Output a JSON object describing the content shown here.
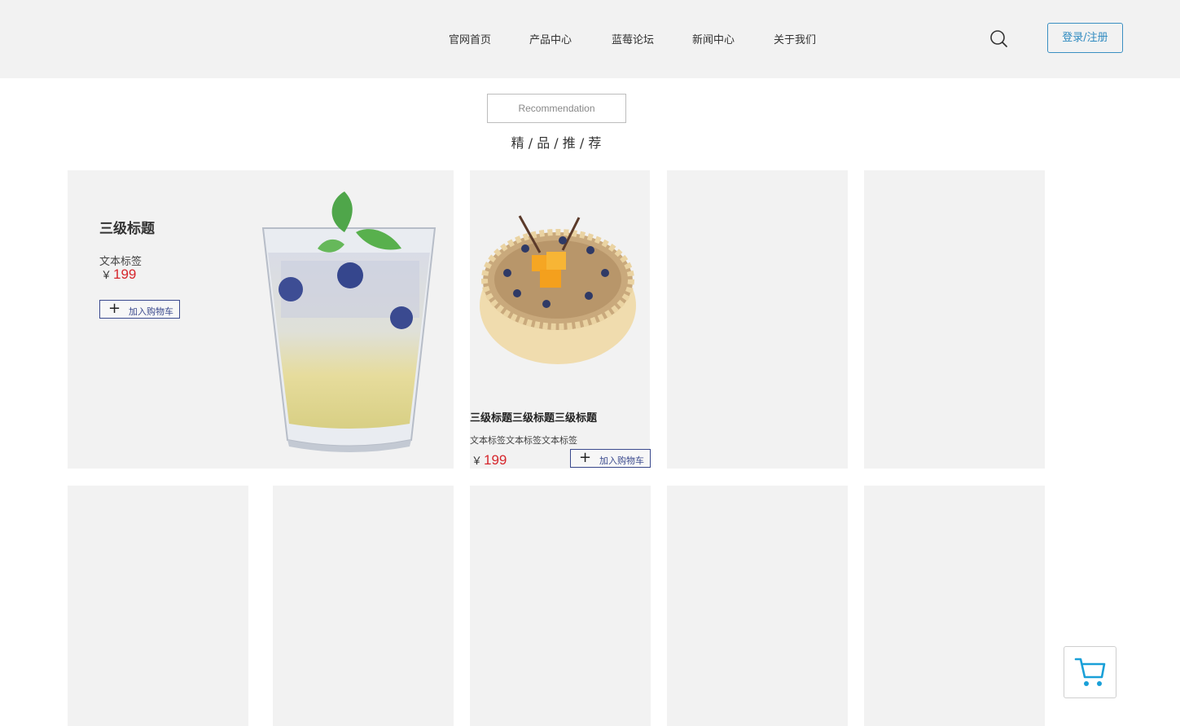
{
  "nav": {
    "items": [
      "官网首页",
      "产品中心",
      "蓝莓论坛",
      "新闻中心",
      "关于我们"
    ],
    "login_label": "登录/注册",
    "search_icon": "search-icon"
  },
  "section": {
    "en_title": "Recommendation",
    "cn_title": "精 / 品 / 推 / 荐"
  },
  "featured": {
    "title": "三级标题",
    "subtitle": "文本标签",
    "currency": "￥",
    "price": "199",
    "cart_label": "加入购物车",
    "image": "blueberry-drink"
  },
  "product": {
    "title": "三级标题三级标题三级标题",
    "subtitle": "文本标签文本标签文本标签",
    "currency": "￥",
    "price": "199",
    "cart_label": "加入购物车",
    "image": "fruit-cake"
  },
  "colors": {
    "accent": "#3a8fc2",
    "price": "#d6262c",
    "card_bg": "#f2f2f2",
    "cart_icon": "#1aa0d8"
  },
  "floating_cart_icon": "shopping-cart-icon"
}
